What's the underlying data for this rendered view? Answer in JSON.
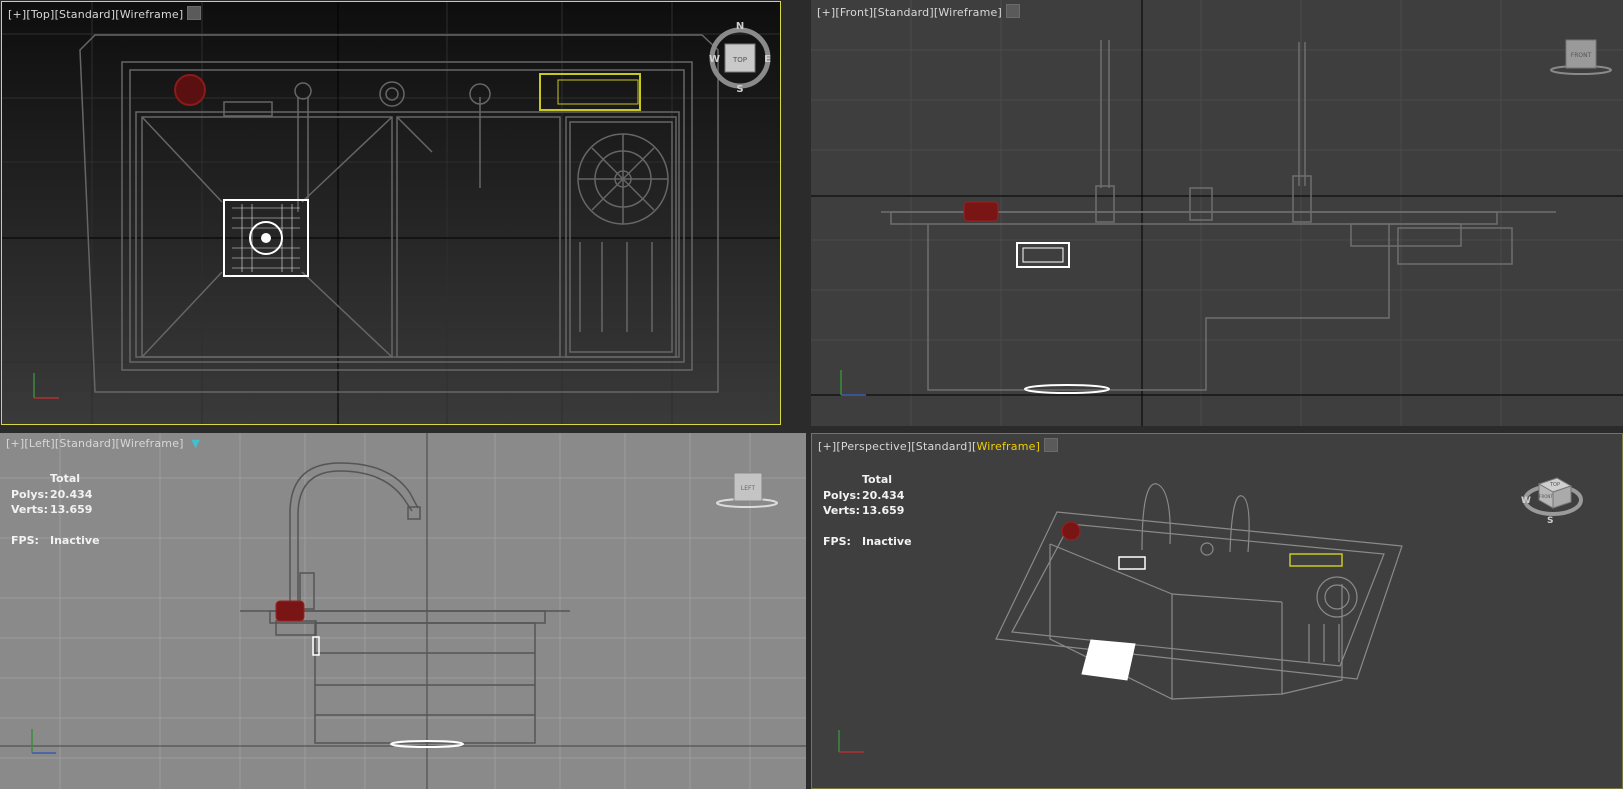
{
  "viewports": {
    "top": {
      "label": {
        "plus": "[+]",
        "view": "[Top]",
        "shading": "[Standard]",
        "mode": "[Wireframe]"
      },
      "viewcube": {
        "face": "TOP",
        "north": "N",
        "south": "S",
        "east": "E",
        "west": "W"
      }
    },
    "front": {
      "label": {
        "plus": "[+]",
        "view": "[Front]",
        "shading": "[Standard]",
        "mode": "[Wireframe]"
      },
      "viewcube": {
        "face": "FRONT"
      }
    },
    "left": {
      "label": {
        "plus": "[+]",
        "view": "[Left]",
        "shading": "[Standard]",
        "mode": "[Wireframe]"
      },
      "viewcube": {
        "face": "LEFT"
      },
      "stats": {
        "header": "Total",
        "polys_label": "Polys:",
        "polys": "20.434",
        "verts_label": "Verts:",
        "verts": "13.659",
        "fps_label": "FPS:",
        "fps": "Inactive"
      }
    },
    "perspective": {
      "label": {
        "plus": "[+]",
        "view": "[Perspective]",
        "shading": "[Standard]",
        "mode": "[Wireframe]"
      },
      "viewcube": {
        "face_top": "TOP",
        "face_front": "FRONT",
        "west": "W",
        "south": "S"
      },
      "stats": {
        "header": "Total",
        "polys_label": "Polys:",
        "polys": "20.434",
        "verts_label": "Verts:",
        "verts": "13.659",
        "fps_label": "FPS:",
        "fps": "Inactive"
      }
    }
  },
  "colors": {
    "active_border": "#d8d840",
    "wire": "#6b6b6b",
    "selected": "#ffffff",
    "drain_red": "#8b1a1a",
    "soap_yellow": "#c8c820",
    "mode_highlight": "#f0d000"
  }
}
